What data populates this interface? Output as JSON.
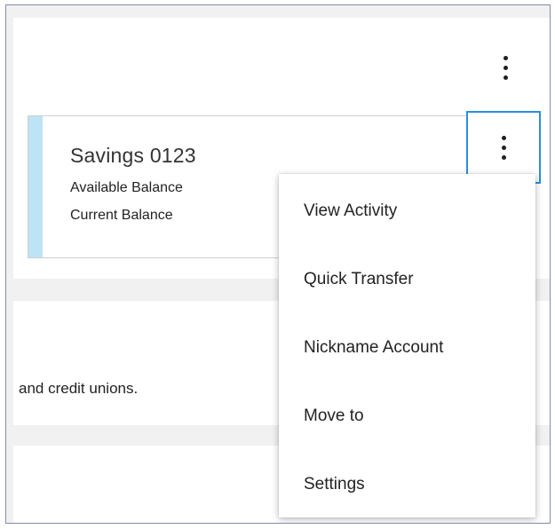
{
  "account": {
    "name": "Savings 0123",
    "available_label": "Available Balance",
    "current_label": "Current Balance",
    "trailing_mark": "·"
  },
  "info": {
    "text": "and credit unions."
  },
  "menu": {
    "items": [
      {
        "label": "View Activity"
      },
      {
        "label": "Quick Transfer"
      },
      {
        "label": "Nickname Account"
      },
      {
        "label": "Move to"
      },
      {
        "label": "Settings"
      }
    ]
  },
  "icons": {
    "header_more": "kebab-vertical-icon",
    "account_more": "kebab-vertical-icon"
  },
  "colors": {
    "accent": "#bde3f6",
    "focus": "#2b8ee0"
  }
}
